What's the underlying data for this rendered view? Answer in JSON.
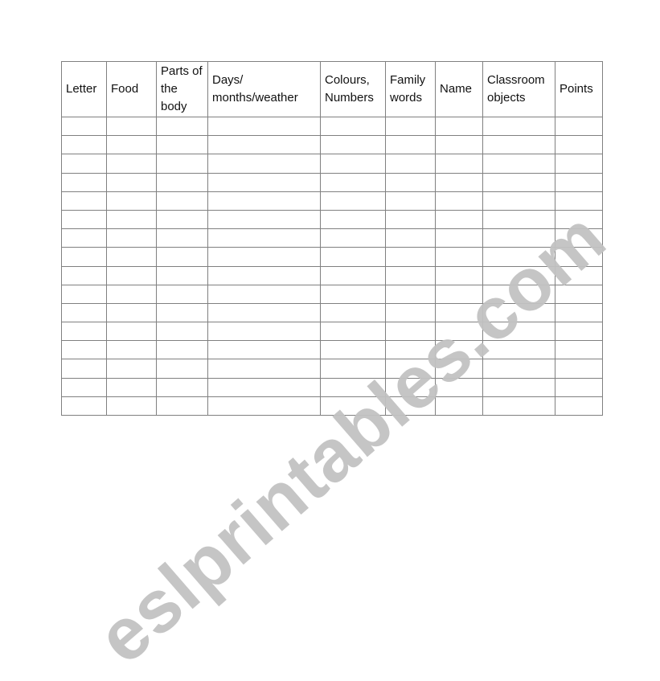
{
  "table": {
    "headers": [
      "Letter",
      "Food",
      "Parts of the body",
      "Days/ months/weather",
      "Colours, Numbers",
      "Family words",
      "Name",
      "Classroom objects",
      "Points"
    ],
    "empty_rows": 16
  },
  "watermark": "eslprintables.com"
}
